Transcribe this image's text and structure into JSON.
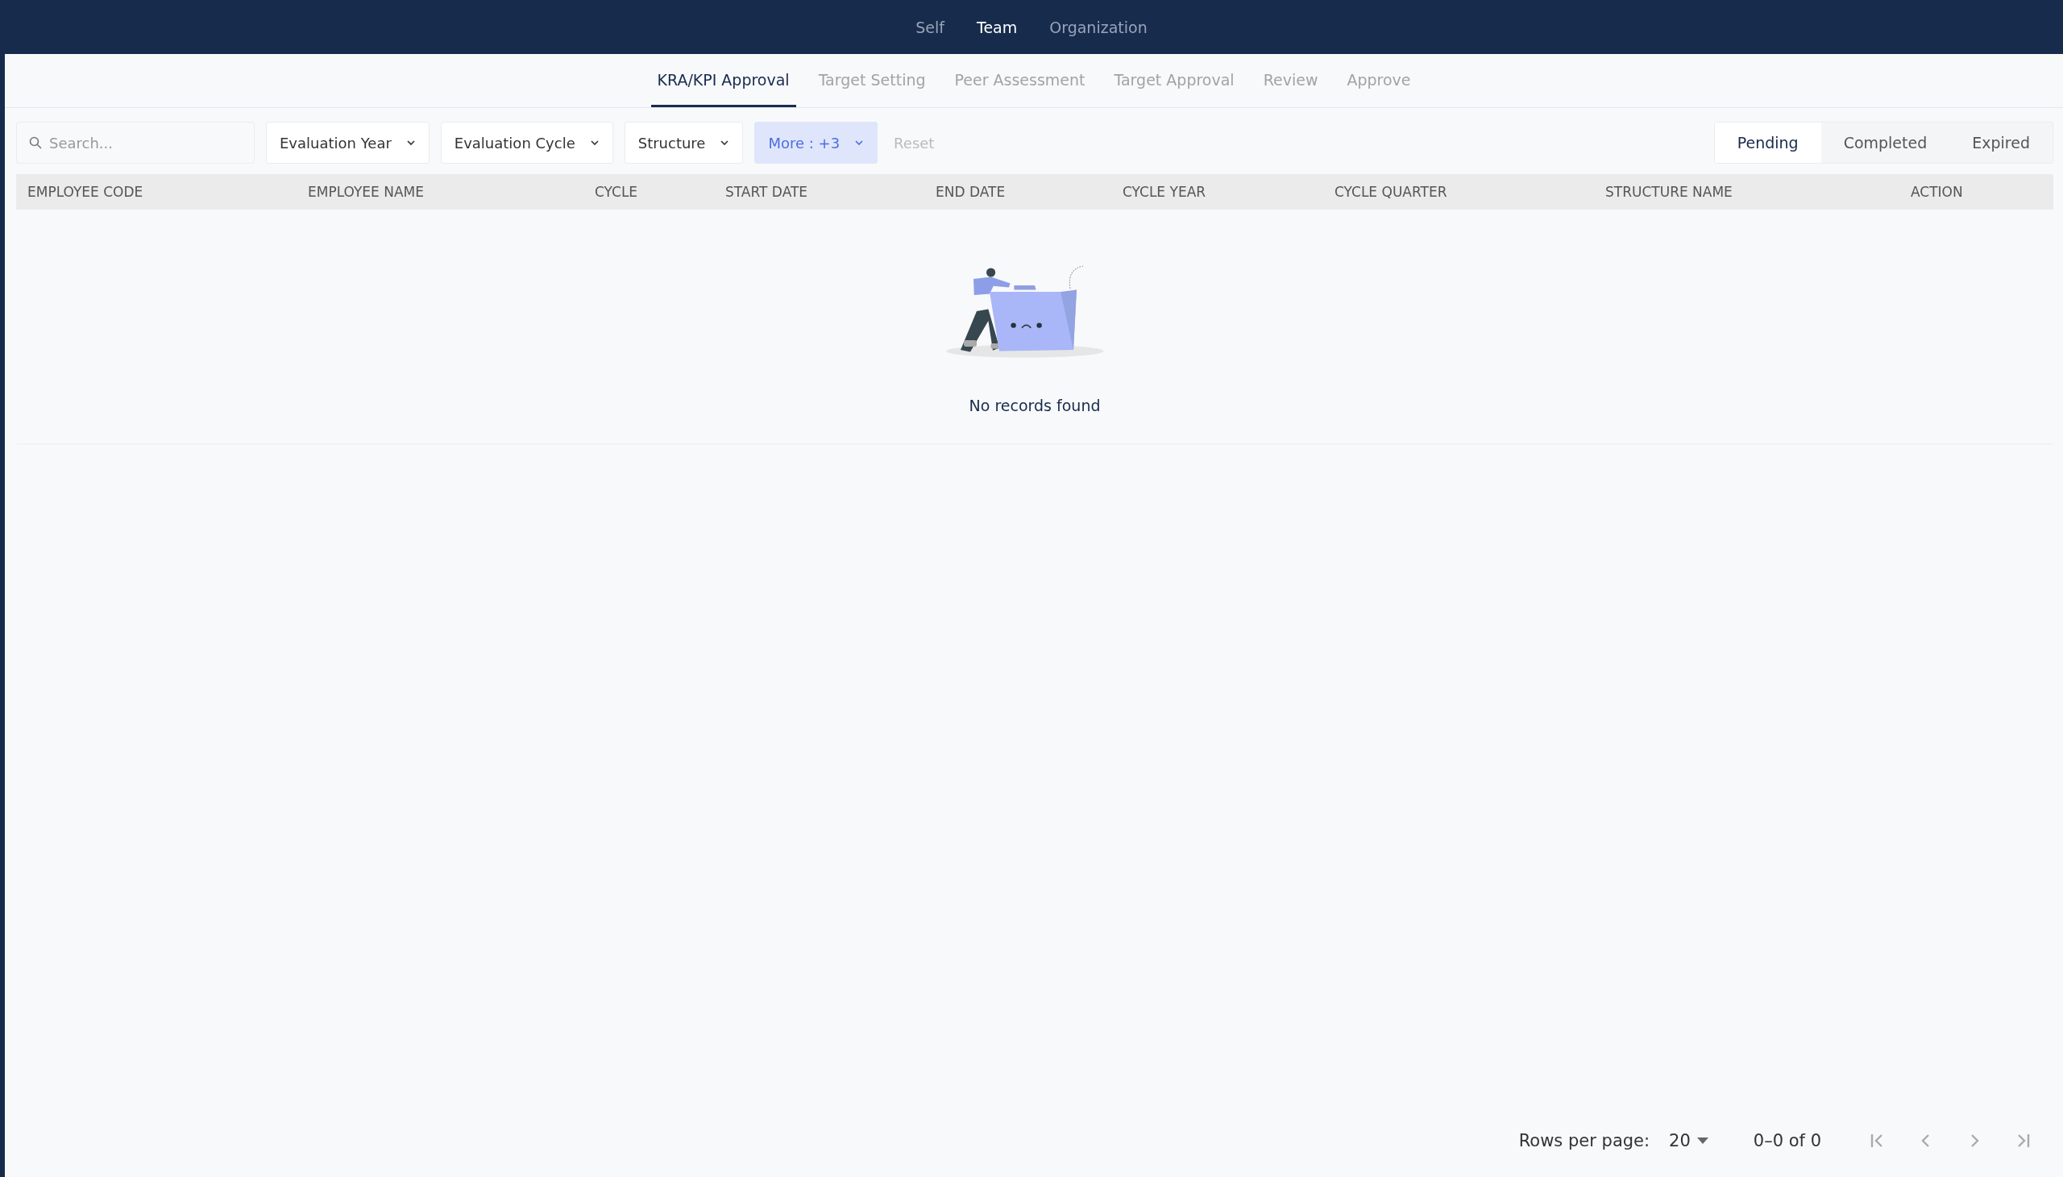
{
  "top_nav": [
    {
      "label": "Self",
      "selected": false
    },
    {
      "label": "Team",
      "selected": true
    },
    {
      "label": "Organization",
      "selected": false
    }
  ],
  "sub_tabs": [
    {
      "label": "KRA/KPI Approval",
      "selected": true
    },
    {
      "label": "Target Setting",
      "selected": false
    },
    {
      "label": "Peer Assessment",
      "selected": false
    },
    {
      "label": "Target Approval",
      "selected": false
    },
    {
      "label": "Review",
      "selected": false
    },
    {
      "label": "Approve",
      "selected": false
    }
  ],
  "search": {
    "placeholder": "Search..."
  },
  "filters": [
    {
      "label": "Evaluation Year",
      "active": false
    },
    {
      "label": "Evaluation Cycle",
      "active": false
    },
    {
      "label": "Structure",
      "active": false
    },
    {
      "label": "More : +3",
      "active": true
    }
  ],
  "reset": {
    "label": "Reset",
    "disabled": true
  },
  "status_tabs": [
    {
      "label": "Pending",
      "selected": true
    },
    {
      "label": "Completed",
      "selected": false
    },
    {
      "label": "Expired",
      "selected": false
    }
  ],
  "table": {
    "columns": [
      "EMPLOYEE CODE",
      "EMPLOYEE NAME",
      "CYCLE",
      "START DATE",
      "END DATE",
      "CYCLE YEAR",
      "CYCLE QUARTER",
      "STRUCTURE NAME",
      "ACTION"
    ],
    "empty_message": "No records found"
  },
  "pagination": {
    "rows_per_page_label": "Rows per page:",
    "rows_per_page": "20",
    "range": "0–0 of 0",
    "buttons": [
      {
        "kind": "first",
        "disabled": true
      },
      {
        "kind": "prev",
        "disabled": true
      },
      {
        "kind": "next",
        "disabled": true
      },
      {
        "kind": "last",
        "disabled": true
      }
    ]
  }
}
